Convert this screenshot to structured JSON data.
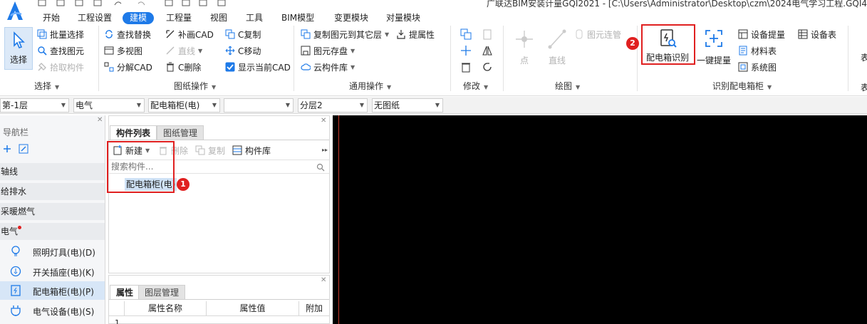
{
  "window": {
    "title": "广联达BIM安装计量GQI2021 - [C:\\Users\\Administrator\\Desktop\\czm\\2024电气学习工程.GQI4"
  },
  "menu": [
    "开始",
    "工程设置",
    "建模",
    "工程量",
    "视图",
    "工具",
    "BIM模型",
    "变更模块",
    "对量模块"
  ],
  "menu_active": "建模",
  "ribbon": {
    "select": {
      "big": "选择",
      "batch": "批量选择",
      "find_elem": "查找图元",
      "pick": "拾取构件",
      "group": "选择"
    },
    "drawing": {
      "find_replace": "查找替换",
      "multi_view": "多视图",
      "explode": "分解CAD",
      "fill_cad": "补画CAD",
      "line": "直线",
      "c_delete": "C删除",
      "c_copy": "C复制",
      "c_move": "C移动",
      "show_current": "显示当前CAD",
      "group": "图纸操作"
    },
    "common": {
      "copy_to": "复制图元到其它层",
      "extract_attr": "提属性",
      "save_elem": "图元存盘",
      "cloud_lib": "云构件库",
      "group": "通用操作"
    },
    "modify": {
      "group": "修改"
    },
    "draw": {
      "point": "点",
      "line": "直线",
      "connect": "图元连管",
      "group": "绘图"
    },
    "identify": {
      "cabinet_identify": "配电箱识别",
      "one_key": "一键提量",
      "device_extract": "设备提量",
      "material_table": "材料表",
      "system_diagram": "系统图",
      "device_table": "设备表",
      "group": "识别配电箱柜",
      "edge": "表"
    }
  },
  "dropdowns": [
    "第-1层",
    "电气",
    "配电箱柜(电)",
    "",
    "分层2",
    "无图纸"
  ],
  "nav": {
    "title": "导航栏",
    "categories": [
      "轴线",
      "给排水",
      "采暖燃气",
      "电气"
    ],
    "items": [
      {
        "label": "照明灯具(电)(D)",
        "icon": "bulb-icon"
      },
      {
        "label": "开关插座(电)(K)",
        "icon": "switch-icon"
      },
      {
        "label": "配电箱柜(电)(P)",
        "icon": "cabinet-icon"
      },
      {
        "label": "电气设备(电)(S)",
        "icon": "plug-icon"
      }
    ],
    "selected": "配电箱柜(电)(P)"
  },
  "component_panel": {
    "tabs": [
      "构件列表",
      "图纸管理"
    ],
    "toolbar": {
      "new": "新建",
      "delete": "删除",
      "copy": "复制",
      "library": "构件库"
    },
    "search_placeholder": "搜索构件...",
    "items": [
      "配电箱柜(电)"
    ]
  },
  "property_panel": {
    "tabs": [
      "属性",
      "图层管理"
    ],
    "columns": [
      "属性名称",
      "属性值",
      "附加"
    ],
    "rows": [
      "1"
    ]
  },
  "annotations": [
    "1",
    "2"
  ],
  "colors": {
    "accent": "#1e7ae8",
    "highlight": "#e02020",
    "canvas": "#000000"
  }
}
